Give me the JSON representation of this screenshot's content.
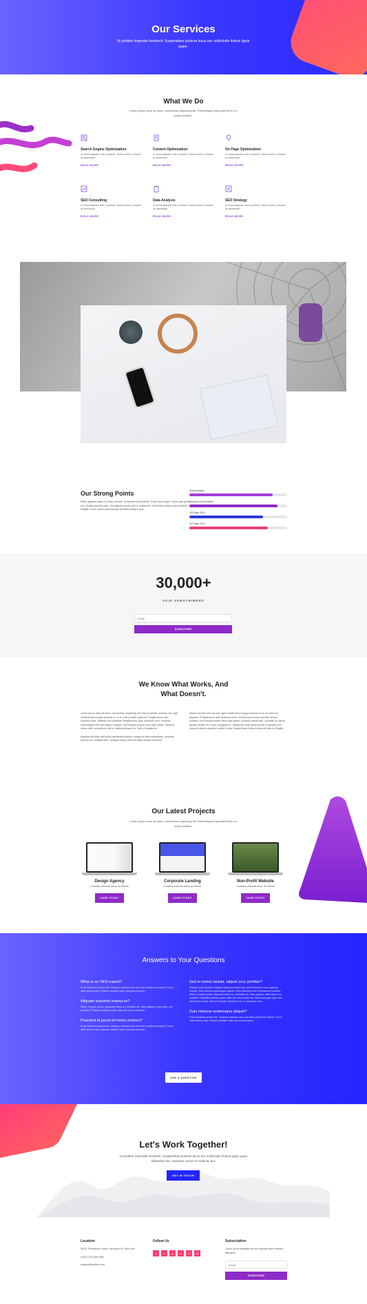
{
  "hero": {
    "title": "Our Services",
    "subtitle": "Ut porttitor imperdiet hendrerit. Suspendisse pulvinar lacus nec sollicitudin finibus ligula quam."
  },
  "what_we_do": {
    "title": "What We Do",
    "subtitle": "Lorem ipsum dolor sit amet, consectetur adipiscing elit. Pellentesque imperdiet libero eu neque facilisis.",
    "services": [
      {
        "icon": "search-icon",
        "title": "Search Engine Optimization",
        "desc": "In luctus aliquam nibh a pretium. Morbi auctor a mauris ac accumsan.",
        "link": "READ MORE"
      },
      {
        "icon": "document-icon",
        "title": "Content Optimization",
        "desc": "In luctus aliquam nibh a pretium. Morbi auctor a mauris ac accumsan.",
        "link": "READ MORE"
      },
      {
        "icon": "location-icon",
        "title": "On Page Optimization",
        "desc": "In luctus aliquam nibh a pretium. Morbi auctor a mauris ac accumsan.",
        "link": "READ MORE"
      },
      {
        "icon": "chart-icon",
        "title": "SEO Consulting",
        "desc": "In luctus aliquam nibh a pretium. Morbi auctor a mauris ac accumsan.",
        "link": "READ MORE"
      },
      {
        "icon": "clipboard-icon",
        "title": "Data Analysis",
        "desc": "In luctus aliquam nibh a pretium. Morbi auctor a mauris ac accumsan.",
        "link": "READ MORE"
      },
      {
        "icon": "strategy-icon",
        "title": "SEO Strategy",
        "desc": "In luctus aliquam nibh a pretium. Morbi auctor a mauris ac accumsan.",
        "link": "READ MORE"
      }
    ]
  },
  "strong_points": {
    "title": "Our Strong Points",
    "text": "Etiam dapibus ipsum in tellus molestie, at blandit metus blandit. Proin dolor neque, luctus quis quam nec, feugiat placerat ante. Sed aliquet iaculis justo in vestibulum. Vestibulum ullamcorper posuere fringilla. Donec ipsum pellentesque convallis tristique quis.",
    "bars": [
      {
        "label": "Data Analysis",
        "value": 0.85,
        "color": "#a63dd8"
      },
      {
        "label": "Business Consultation",
        "value": 0.9,
        "color": "#8e2bc8"
      },
      {
        "label": "Off Page SEO",
        "value": 0.75,
        "color": "#2b3bd8"
      },
      {
        "label": "On Page SEO",
        "value": 0.8,
        "color": "#e8407e"
      }
    ]
  },
  "subscribers": {
    "count": "30,000+",
    "label": "AVID SUBSCRIBERS",
    "email_placeholder": "Email",
    "button": "SUBSCRIBE"
  },
  "what_works": {
    "title_line1": "We Know What Works, And",
    "title_line2": "What Doesn't.",
    "col1_p1": "Lorem ipsum dolor sit amet, consectetur adipiscing elit. Mauris lobortis vehicula nisl, eget condimentum augue pulvinar ut. In ac nulla porttitor placerat. Fringilla lacus quis, euismod enim. Vivamus non placerat. Fringilla lacus quis, euismod enim. Vivamus pellentesque sed nibh dictum sodales. Sed tempus tempor risus eget varius. Vivamus metus nibh, convallis eu nisl at, facilisis tempor leo. Nam a fringilla leo.",
    "col1_p2": "Aliquam elit dolor sed luctus elementum dictum. Integer at enim scelerisque, molestie mauris non, sodales ante. Quisque finibus nibh sed diam semper euismod.",
    "col2_p1": "Mauris lobortis vehicula nisl, eget condimentum augue pulvinar ut. In ac nulla nec placerat. Fringilla lacus quis, euismod enim. Vivamus accumsan sed nibh dictum sodales. Sed tempus tempor risus eget varius. Vivamus metus nibh, convallis eu nisl at, facilisis tempor leo. Nam a fringilla leo. Vestibulum ante ipsum primis in faucibus orci luctus et ultrices posuere cubilia Curae; Suspendisse tempor euismod felis eu fringilla."
  },
  "projects": {
    "title": "Our Latest Projects",
    "subtitle": "Lorem ipsum dolor sit amet, consectetur adipiscing elit. Pellentesque imperdiet libero eu neque facilisis.",
    "items": [
      {
        "title": "Design Agency",
        "desc": "Curabitur placerat lacus, at ultrices",
        "button": "CASE STUDY"
      },
      {
        "title": "Corporate Landing",
        "desc": "Curabitur placerat lacus, at ultrices",
        "button": "CASE STUDY"
      },
      {
        "title": "Non-Profit Website",
        "desc": "Curabitur placerat lacus, at ultrices",
        "button": "CASE STUDY"
      }
    ]
  },
  "faq": {
    "title": "Answers to Your Questions",
    "items": [
      {
        "q": "What is an SEO expert?",
        "a": "Proin maximus viverra elit. Vivamus vehicula arcu sed nibh vestibulum lacinia. Fusce vitae viverra risus. Mauris molestie vitae erat quis tincidunt."
      },
      {
        "q": "Aliquam euismod massa ex?",
        "a": "Etiam in turpis auctor, dignissim tellus eu, molestie elit. Nam dapibus vitae tellus non sodales. Phasellus pretium quam vitae dui viverra placerat."
      },
      {
        "q": "Praesent id purus id metus pretium?",
        "a": "Proin maximus viverra elit. Vivamus vehicula arcu sed nibh vestibulum lacinia. Fusce vitae viverra risus. Mauris molestie vitae erat quis tincidunt."
      },
      {
        "q": "Sed et metus lacinia, aliquet arcu porttitor?",
        "a": "Aliquam erat volutpat. Aliquam euismod massa est, sed fermentum nunc egestas semper. Duis rhoncus scelerisque aliquet. Duis vehicula nunc a elementum facilisis. Etiam in turpis auctor, dignissim tellus eu, molestie elit. Nam dapibus vitae tellus non sodales. Phasellus pretium quam vitae dui viverra placerat. Nulla quis justo eget ante elementum porta. Duis et nisl quis ultricies eros, in commodo dolor."
      },
      {
        "q": "Duis rhoncus scelerisque aliquet?",
        "a": "Proin maximus viverra elit. Vivamus vehicula arcu sed nibh vestibulum lacinia. Fusce vitae viverra risus. Mauris molestie vitae erat quis tincidunt."
      }
    ],
    "button": "ASK A QUESTION"
  },
  "cta": {
    "title": "Let's Work Together!",
    "subtitle": "Ut porttitor imperdiet hendrerit. Suspendisse pulvinar lacus nec sollicitudin finibus ligula quam bibendum dui, maximus ornare ex nulla ac dui.",
    "button": "GET IN TOUCH"
  },
  "footer": {
    "location_title": "Location",
    "address": "5032L Providence Tower, Paramore St. New York",
    "phone": "(+012) 123 456 7899",
    "email": "support@seofirm.com",
    "follow_title": "Follow Us",
    "socials": [
      "f",
      "t",
      "g",
      "p",
      "in",
      "ig"
    ],
    "subscription_title": "Subscription",
    "subscription_text": "Lorem ipsum available but the majority have suffered alteration.",
    "email_placeholder": "Email",
    "button": "SUBSCRIBE"
  },
  "colors": {
    "primary_blue": "#3b37ff",
    "purple": "#8e2bc8",
    "pink": "#ff4a7a"
  }
}
